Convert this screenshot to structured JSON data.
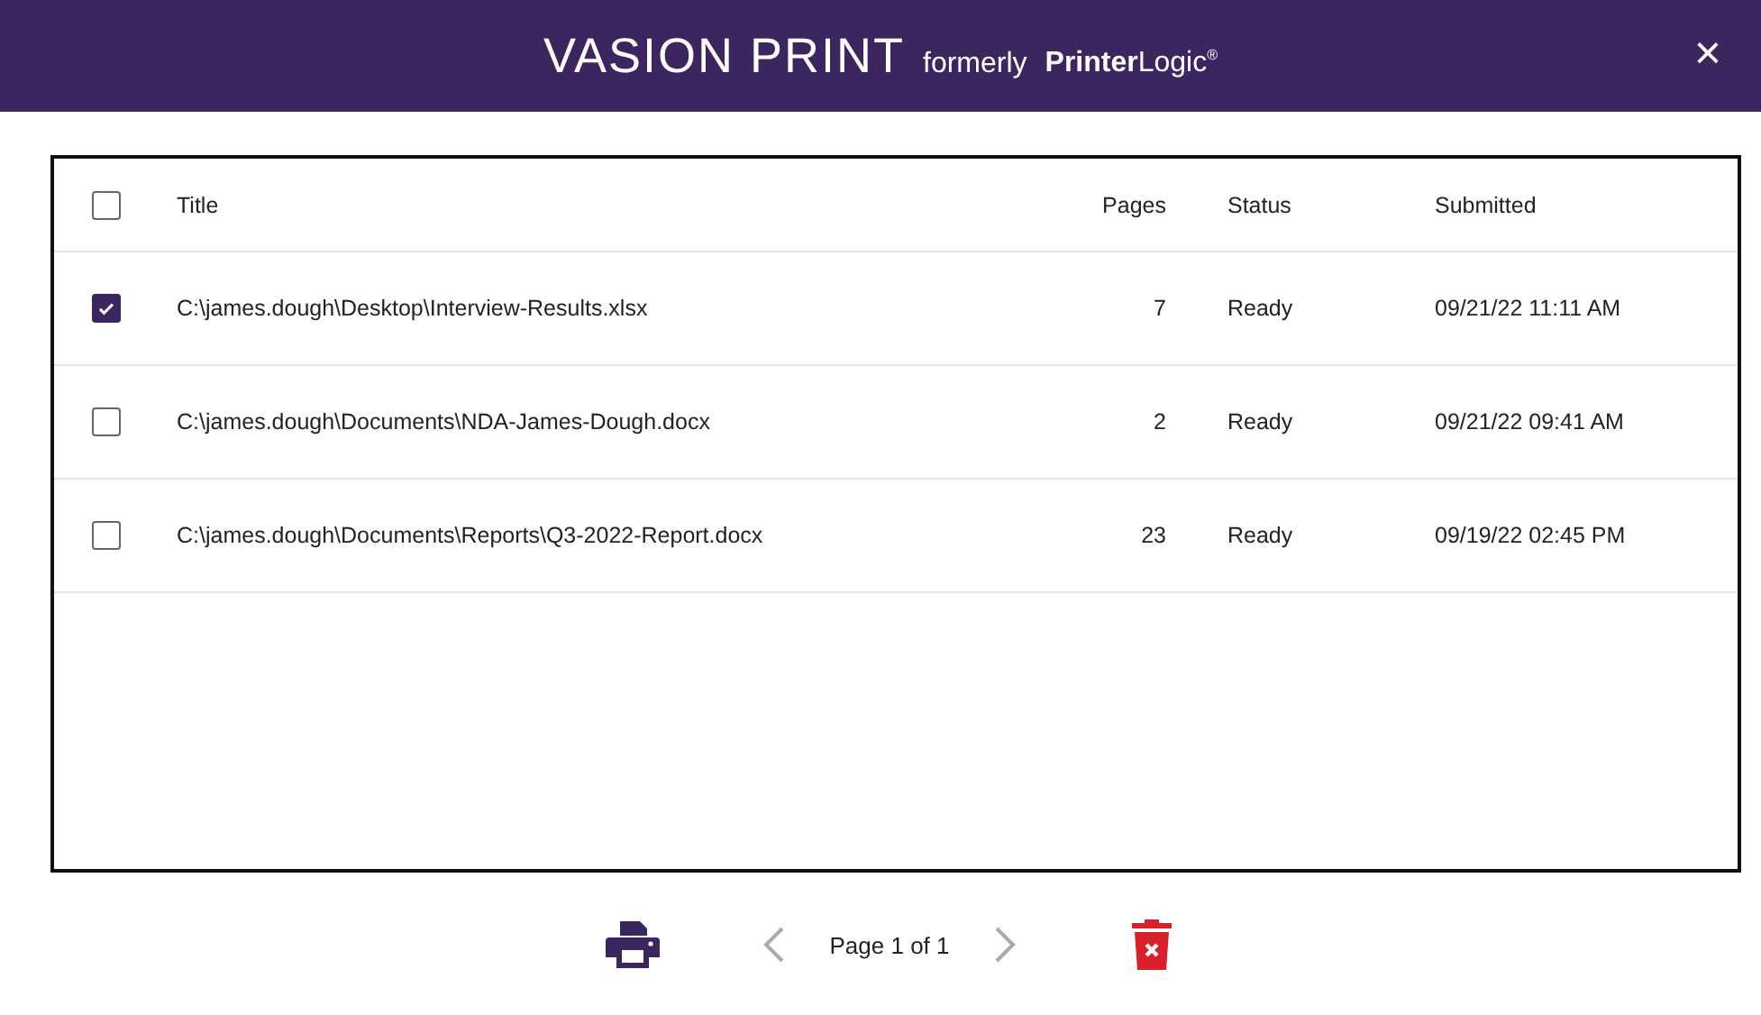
{
  "header": {
    "brand": "VASION PRINT",
    "tagline": "formerly",
    "former_brand": "**Printer**Logic$^{®}$",
    "close": "×"
  },
  "table": {
    "select_all": {
      "checked": false
    },
    "columns": [
      "Title",
      "Pages",
      "Status",
      "Submitted"
    ],
    "rows": [
      {
        "checked": true,
        "title": "C:\\james.dough\\Desktop\\Interview-Results.xlsx",
        "pages": "7",
        "status": "Ready",
        "submitted": "09/21/22 11:11 AM"
      },
      {
        "checked": false,
        "title": "C:\\james.dough\\Documents\\NDA-James-Dough.docx",
        "pages": "2",
        "status": "Ready",
        "submitted": "09/21/22 09:41 AM"
      },
      {
        "checked": false,
        "title": "C:\\james.dough\\Documents\\Reports\\Q3-2022-Report.docx",
        "pages": "23",
        "status": "Ready",
        "submitted": "09/19/22 02:45 PM"
      }
    ]
  },
  "pager": {
    "label": "Page 1 of 1",
    "prev_disabled": true,
    "next_disabled": true
  }
}
